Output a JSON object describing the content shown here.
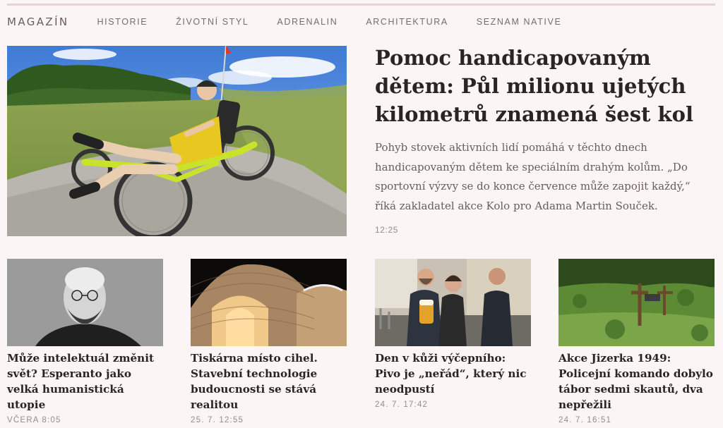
{
  "nav": {
    "brand": "MAGAZÍN",
    "items": [
      "HISTORIE",
      "ŽIVOTNÍ STYL",
      "ADRENALIN",
      "ARCHITEKTURA",
      "SEZNAM NATIVE"
    ]
  },
  "hero": {
    "title": "Pomoc handicapovaným dětem: Půl milionu ujetých kilometrů znamená šest kol",
    "perex": "Pohyb stovek aktivních lidí pomáhá v těchto dnech handicapovaným dětem ke speciálním drahým kolům. „Do sportovní výzvy se do konce července může zapojit každý,“ říká zakladatel akce Kolo pro Adama Martin Souček.",
    "time": "12:25"
  },
  "articles": [
    {
      "title": "Může intelektuál změnit svět? Esperanto jako velká humanistická utopie",
      "time": "VČERA 8:05"
    },
    {
      "title": "Tiskárna místo cihel. Stavební technologie budoucnosti se stává realitou",
      "time": "25. 7. 12:55"
    },
    {
      "title": "Den v kůži výčepního: Pivo je „neřád“, který nic neodpustí",
      "time": "24. 7. 17:42"
    },
    {
      "title": "Akce Jizerka 1949: Policejní komando dobylo tábor sedmi skautů, dva nepřežili",
      "time": "24. 7. 16:51"
    }
  ],
  "colors": {
    "background": "#fcf5f5",
    "title": "#2c2424",
    "meta": "#9a8a8a"
  }
}
